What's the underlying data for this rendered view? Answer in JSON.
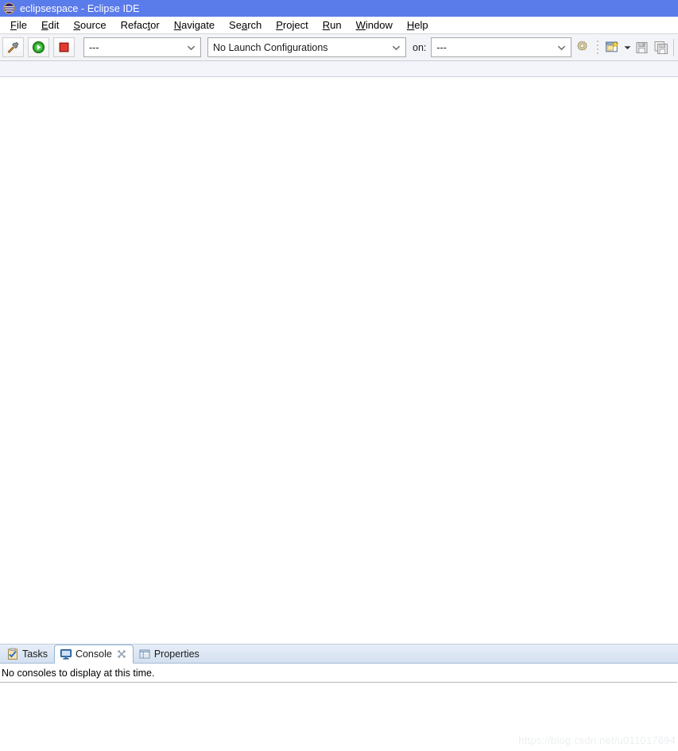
{
  "window": {
    "title": "eclipsespace - Eclipse IDE",
    "app_icon": "eclipse-icon",
    "titlebar_color": "#5a7bea"
  },
  "menubar": {
    "items": [
      {
        "label": "File",
        "mnemonic": "F"
      },
      {
        "label": "Edit",
        "mnemonic": "E"
      },
      {
        "label": "Source",
        "mnemonic": "S"
      },
      {
        "label": "Refactor",
        "mnemonic": "t"
      },
      {
        "label": "Navigate",
        "mnemonic": "N"
      },
      {
        "label": "Search",
        "mnemonic": "a"
      },
      {
        "label": "Project",
        "mnemonic": "P"
      },
      {
        "label": "Run",
        "mnemonic": "R"
      },
      {
        "label": "Window",
        "mnemonic": "W"
      },
      {
        "label": "Help",
        "mnemonic": "H"
      }
    ]
  },
  "toolbar": {
    "build_button": {
      "icon": "hammer-icon",
      "tooltip": "Build"
    },
    "run_button": {
      "icon": "run-play-icon",
      "tooltip": "Run"
    },
    "stop_button": {
      "icon": "stop-square-icon",
      "tooltip": "Stop"
    },
    "target_combo": {
      "value": "---",
      "icon": "chevron-down-icon"
    },
    "launch_config_combo": {
      "value": "No Launch Configurations",
      "icon": "chevron-down-icon"
    },
    "on_label": "on:",
    "on_combo": {
      "value": "---",
      "icon": "chevron-down-icon"
    },
    "settings_button": {
      "icon": "gear-icon"
    },
    "new_button": {
      "icon": "new-file-icon"
    },
    "new_dropdown": {
      "icon": "chevron-down-small-icon"
    },
    "save_button": {
      "icon": "save-icon",
      "enabled": false
    },
    "save_all_button": {
      "icon": "save-all-icon",
      "enabled": false
    }
  },
  "bottom_panel": {
    "tabs": [
      {
        "label": "Tasks",
        "icon": "tasks-icon",
        "active": false,
        "closable": false
      },
      {
        "label": "Console",
        "icon": "console-icon",
        "active": true,
        "closable": true
      },
      {
        "label": "Properties",
        "icon": "properties-icon",
        "active": false,
        "closable": false
      }
    ],
    "console_message": "No consoles to display at this time."
  },
  "watermark": {
    "text": "https://blog.csdn.net/u011017694"
  }
}
